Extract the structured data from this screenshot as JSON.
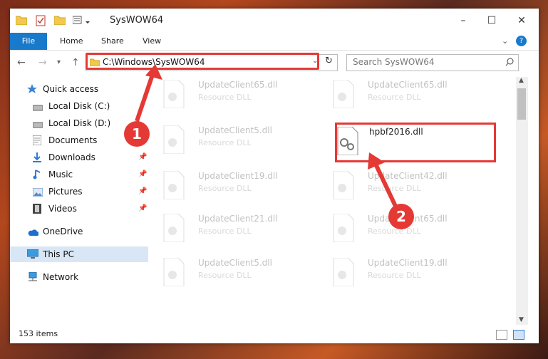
{
  "window": {
    "title": "SysWOW64"
  },
  "ribbon": {
    "tabs": [
      "File",
      "Home",
      "Share",
      "View"
    ]
  },
  "address": {
    "path": "C:\\Windows\\SysWOW64"
  },
  "search": {
    "placeholder": "Search SysWOW64"
  },
  "sidebar": {
    "items": [
      {
        "label": "Quick access",
        "icon": "star-icon"
      },
      {
        "label": "Local Disk (C:)",
        "icon": "disk-icon"
      },
      {
        "label": "Local Disk (D:)",
        "icon": "disk-icon"
      },
      {
        "label": "Documents",
        "icon": "document-icon"
      },
      {
        "label": "Downloads",
        "icon": "download-icon"
      },
      {
        "label": "Music",
        "icon": "music-icon"
      },
      {
        "label": "Pictures",
        "icon": "pictures-icon"
      },
      {
        "label": "Videos",
        "icon": "video-icon"
      },
      {
        "label": "OneDrive",
        "icon": "cloud-icon"
      },
      {
        "label": "This PC",
        "icon": "computer-icon"
      },
      {
        "label": "Network",
        "icon": "network-icon"
      }
    ]
  },
  "files": [
    {
      "name": "UpdateClient65.dll",
      "type": "Resource DLL"
    },
    {
      "name": "UpdateClient65.dll",
      "type": "Resource DLL"
    },
    {
      "name": "UpdateClient5.dll",
      "type": "Resource DLL"
    },
    {
      "name": "hpbf2016.dll",
      "type": ""
    },
    {
      "name": "UpdateClient19.dll",
      "type": "Resource DLL"
    },
    {
      "name": "UpdateClient42.dll",
      "type": "Resource DLL"
    },
    {
      "name": "UpdateClient21.dll",
      "type": "Resource DLL"
    },
    {
      "name": "UpdateClient65.dll",
      "type": "Resource DLL"
    },
    {
      "name": "UpdateClient5.dll",
      "type": "Resource DLL"
    },
    {
      "name": "UpdateClient19.dll",
      "type": "Resource DLL"
    }
  ],
  "status": {
    "count": "153 items"
  },
  "annotations": {
    "step1": "1",
    "step2": "2",
    "color": "#e53935"
  }
}
